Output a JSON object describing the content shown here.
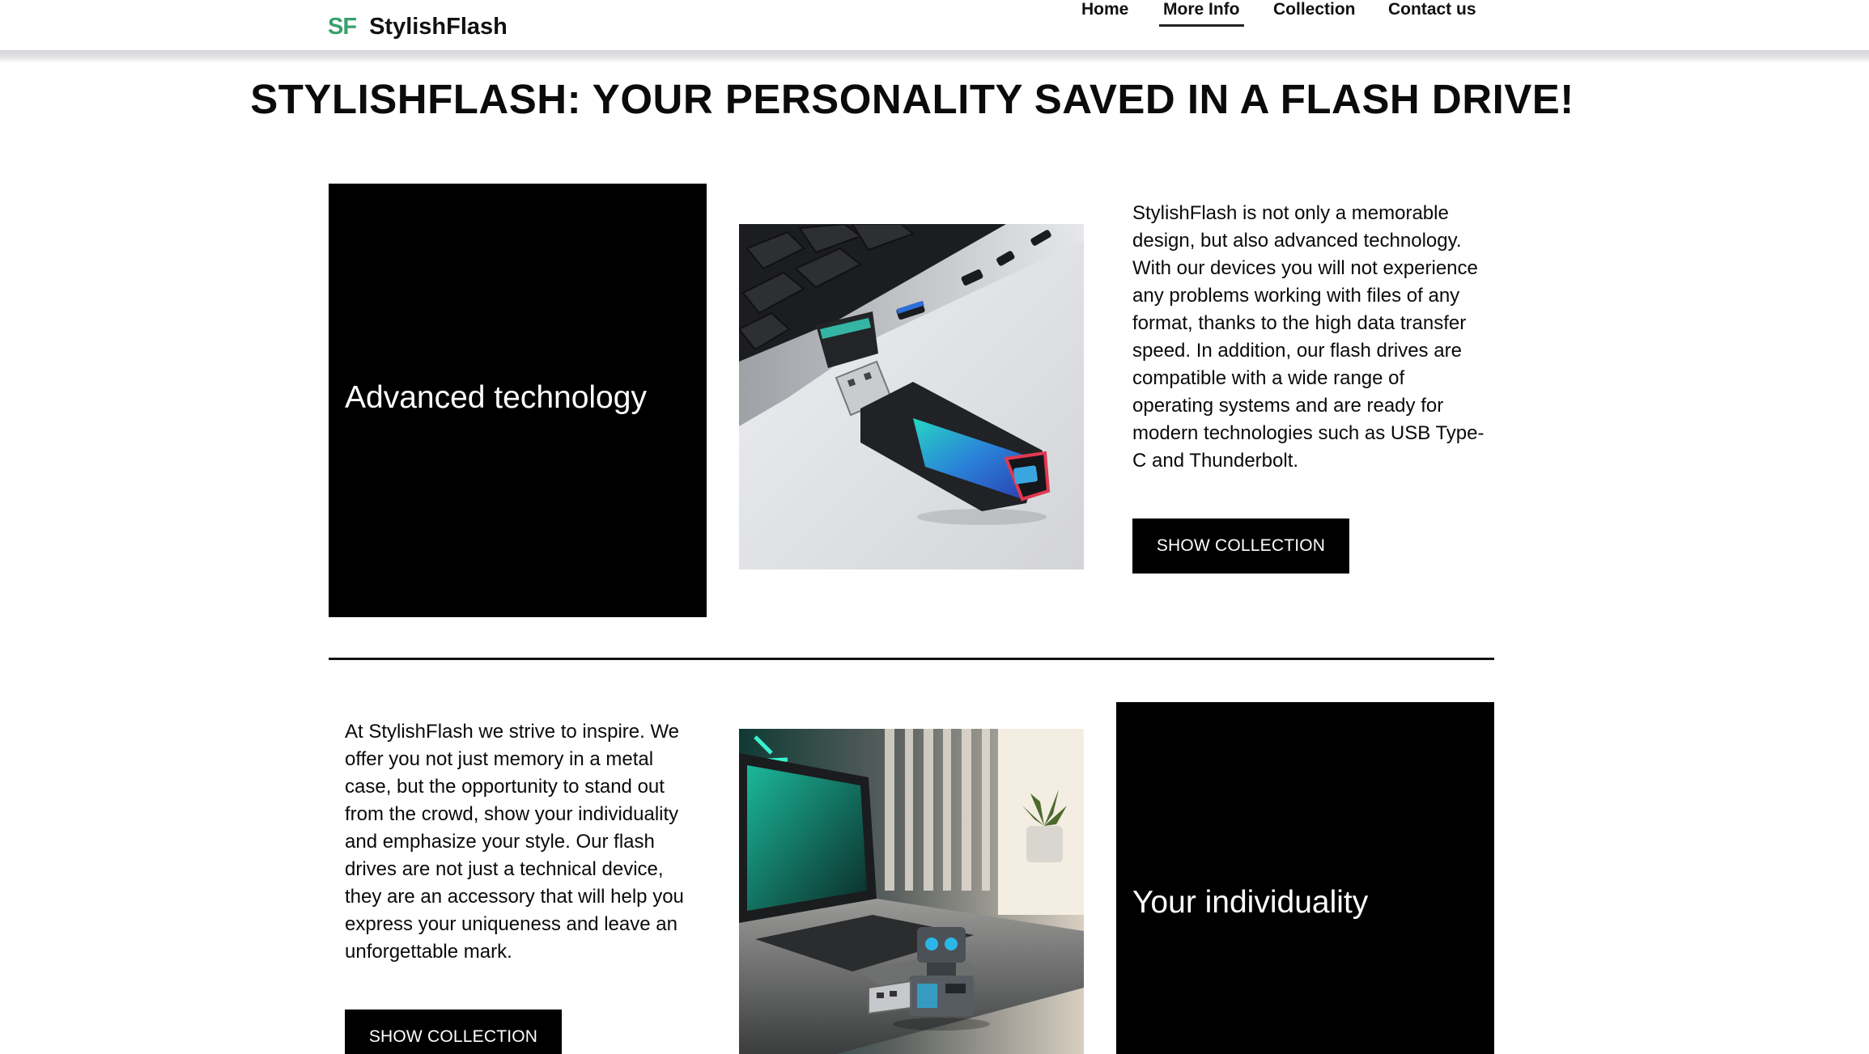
{
  "header": {
    "logo_mark": "SF",
    "brand_name": "StylishFlash",
    "nav": [
      {
        "label": "Home",
        "active": false
      },
      {
        "label": "More Info",
        "active": true
      },
      {
        "label": "Collection",
        "active": false
      },
      {
        "label": "Contact us",
        "active": false
      }
    ]
  },
  "page": {
    "title": "STYLISHFLASH: YOUR PERSONALITY SAVED IN A FLASH DRIVE!"
  },
  "section1": {
    "panel_label": "Advanced technology",
    "image_subject": "usb-flash-drive-in-laptop",
    "paragraph": "StylishFlash is not only a memorable design, but also advanced technology. With our devices you will not experience any problems working with files of any format, thanks to the high data transfer speed. In addition, our flash drives are compatible with a wide range of operating systems and are ready for modern technologies such as USB Type-C and Thunderbolt.",
    "button_label": "SHOW COLLECTION"
  },
  "section2": {
    "paragraph": "At StylishFlash we strive to inspire. We offer you not just memory in a metal case, but the opportunity to stand out from the crowd, show your individuality and emphasize your style. Our flash drives are not just a technical device, they are an accessory that will help you express your uniqueness and leave an unforgettable mark.",
    "button_label": "SHOW COLLECTION",
    "image_subject": "robot-flash-drive-on-laptop",
    "panel_label": "Your individuality"
  },
  "colors": {
    "brand_green": "#3aa06b",
    "panel_black": "#000000",
    "text": "#0a0a0a"
  }
}
